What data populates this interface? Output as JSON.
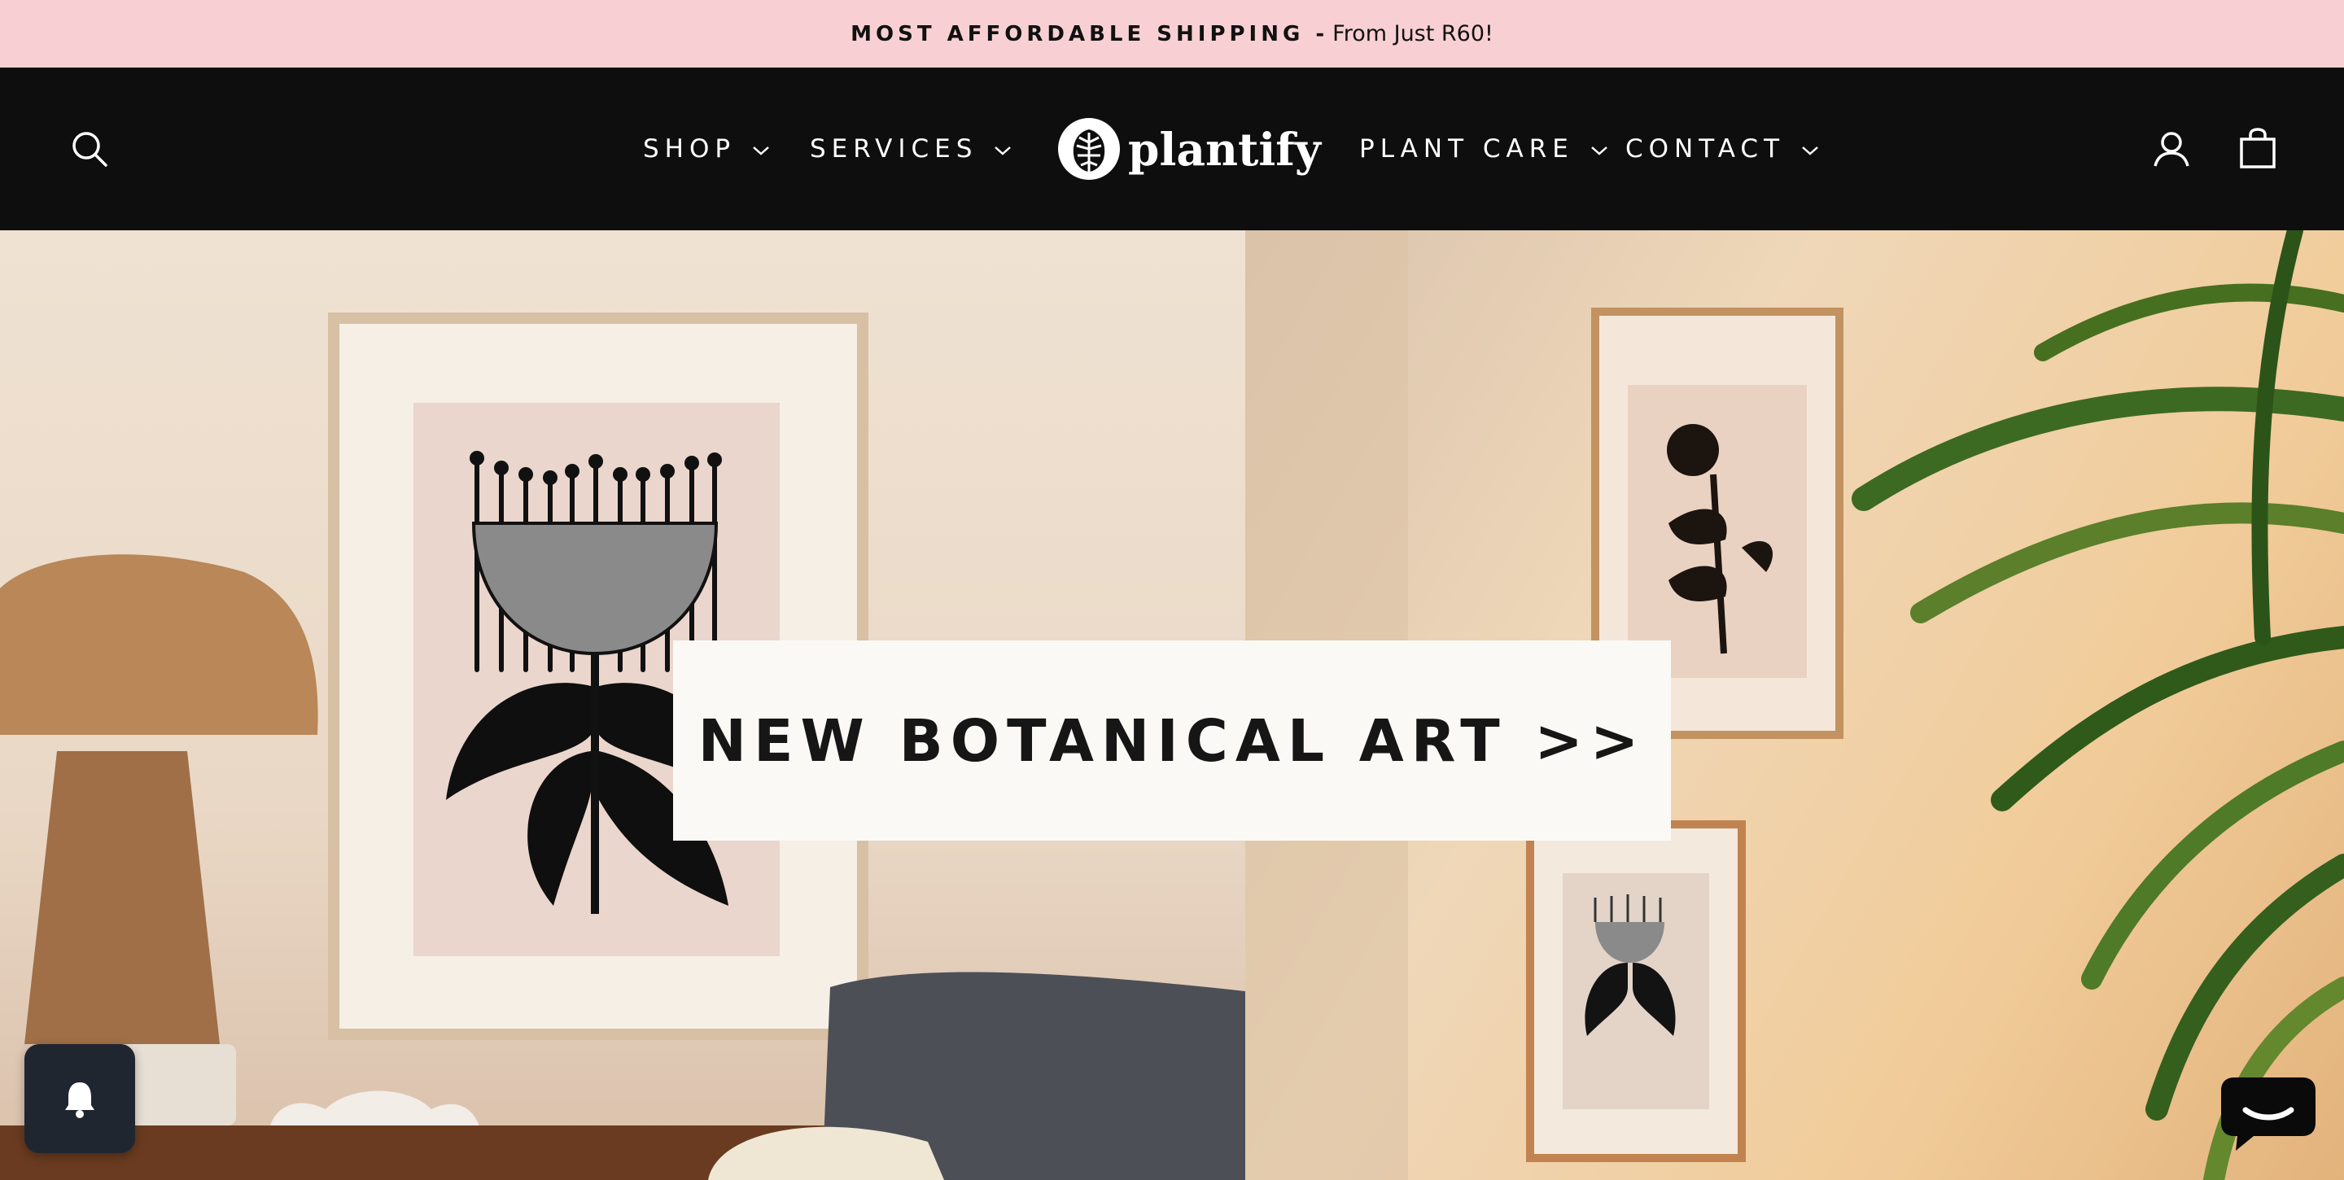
{
  "announcement": {
    "highlight": "MOST AFFORDABLE SHIPPING",
    "separator": "-",
    "text": "From Just R60!"
  },
  "header": {
    "logo_text": "plantify",
    "nav": [
      {
        "label": "SHOP"
      },
      {
        "label": "SERVICES"
      },
      {
        "label": "PLANT CARE"
      },
      {
        "label": "CONTACT"
      }
    ],
    "icons": {
      "search": "search-icon",
      "account": "user-icon",
      "cart": "shopping-bag-icon"
    }
  },
  "hero": {
    "banner_text": "NEW BOTANICAL ART >>"
  },
  "widgets": {
    "left": "bell-icon",
    "right": "chat-icon"
  },
  "colors": {
    "announcement_bg": "#f8d0d3",
    "header_bg": "#0e0e0e",
    "banner_bg": "#fbf9f6",
    "chat_widget": "#1f2630"
  }
}
